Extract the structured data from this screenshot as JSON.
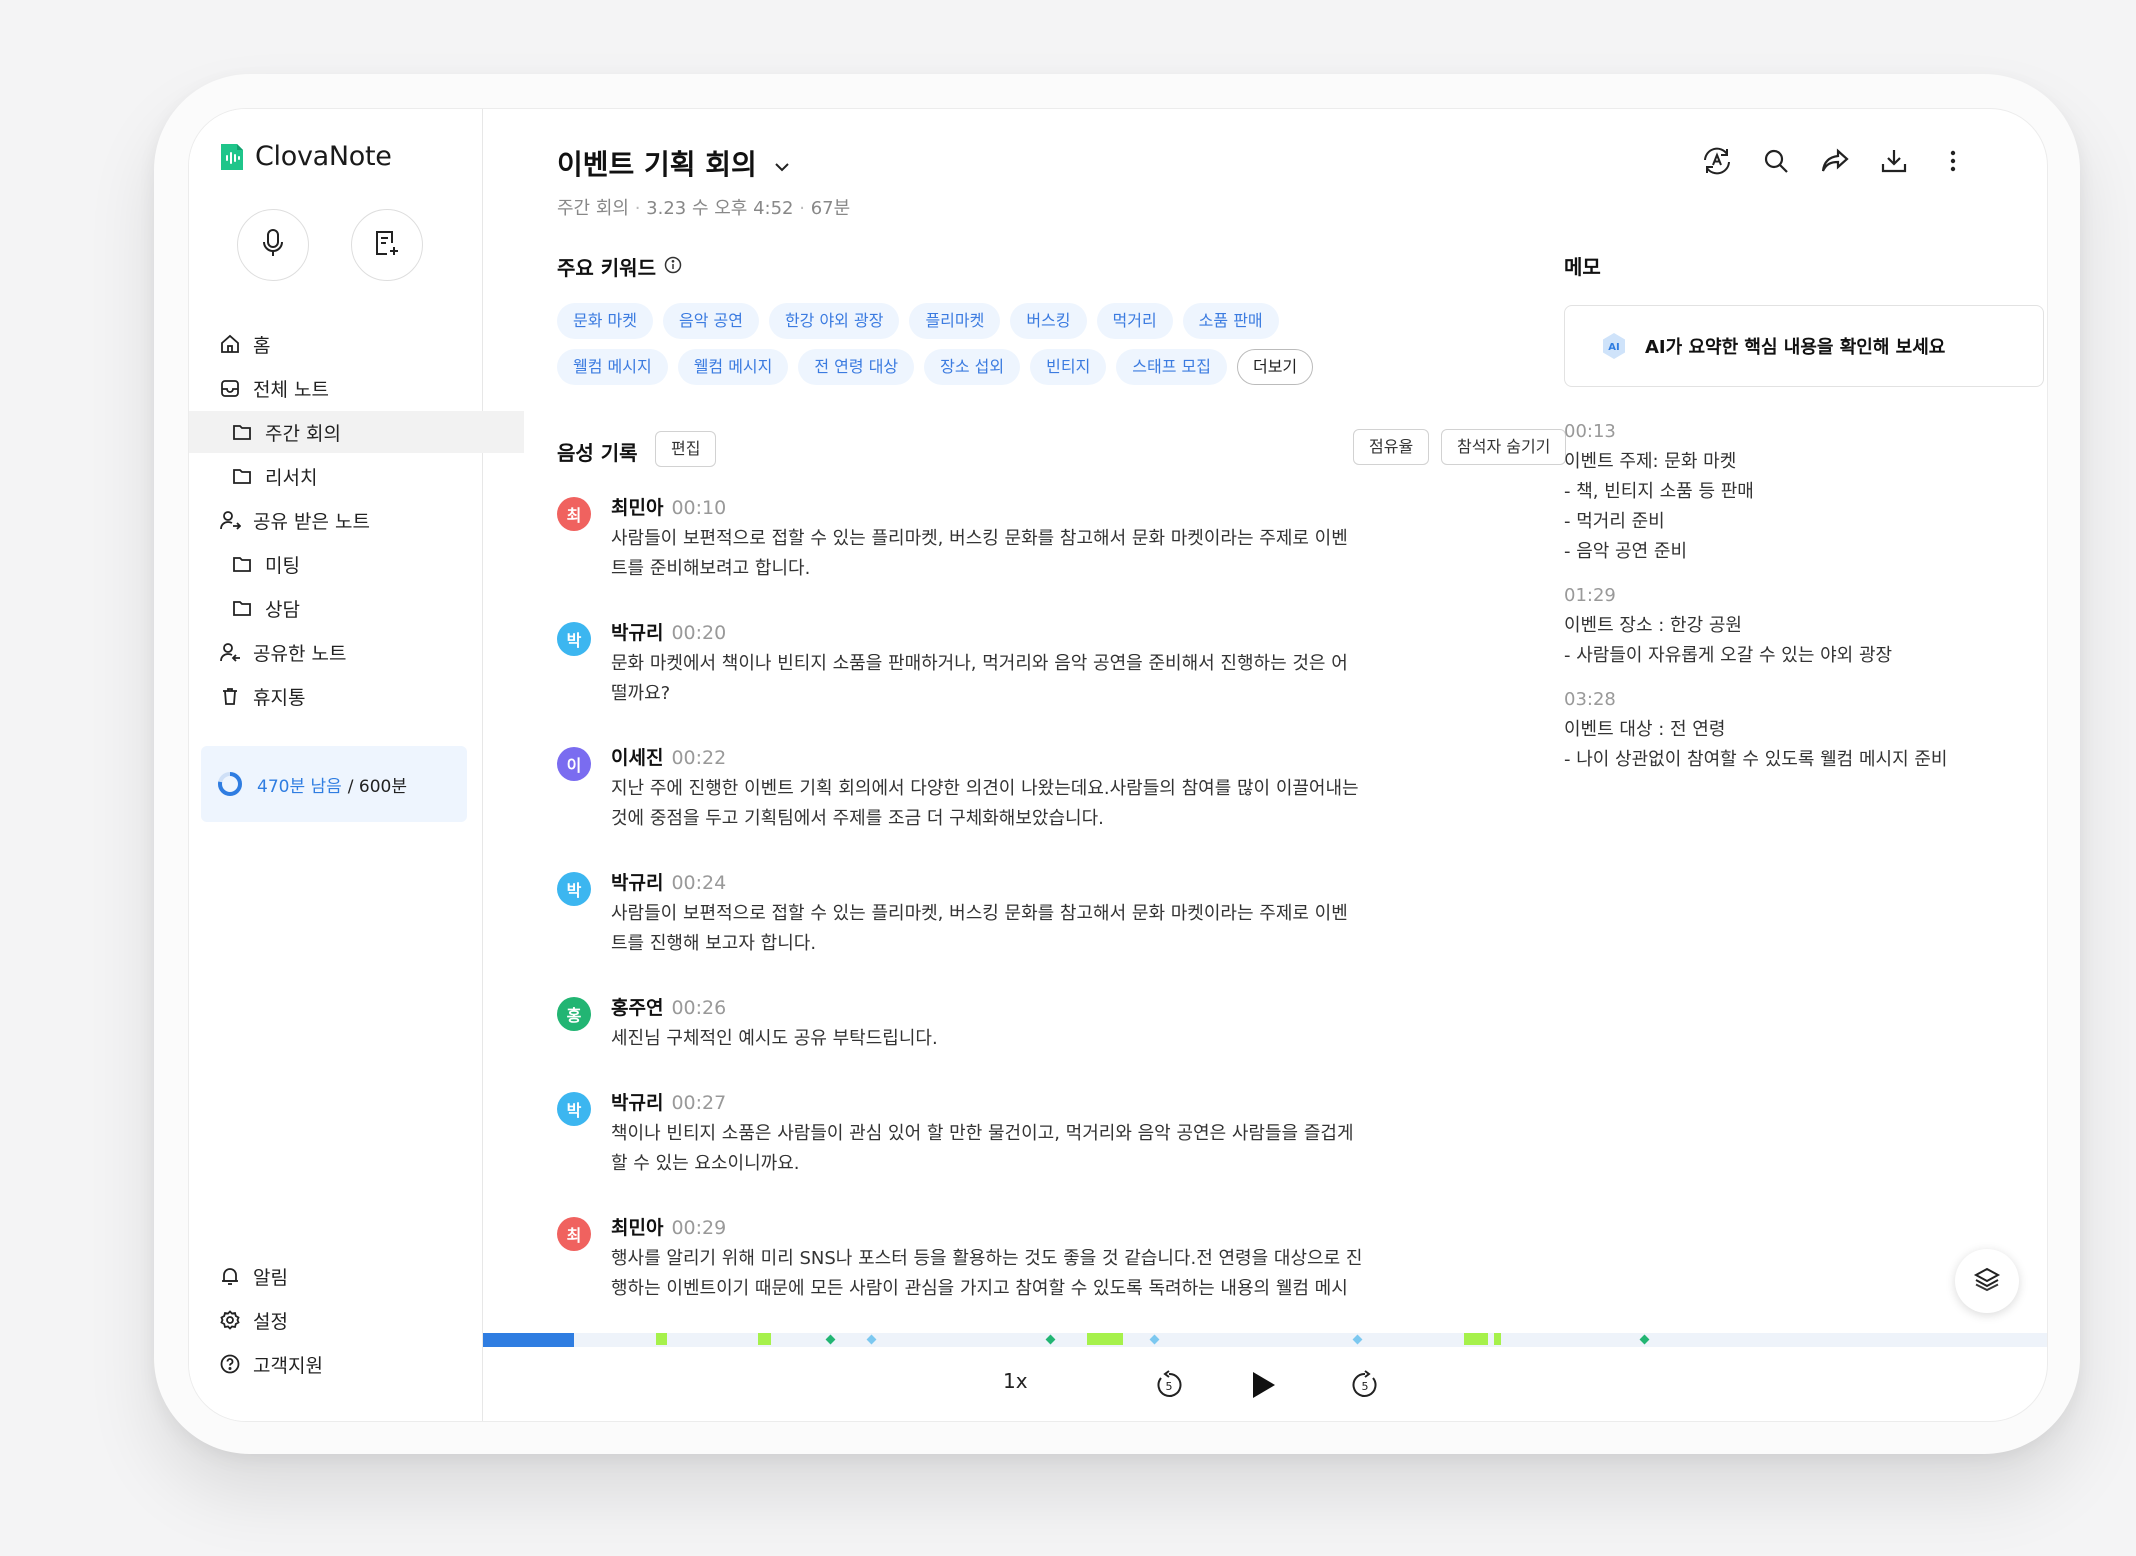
{
  "app": {
    "name": "ClovaNote"
  },
  "sidebar": {
    "items": [
      {
        "label": "홈",
        "icon": "home-icon"
      },
      {
        "label": "전체 노트",
        "icon": "inbox-icon"
      },
      {
        "label": "주간 회의",
        "icon": "folder-icon"
      },
      {
        "label": "리서치",
        "icon": "folder-icon"
      },
      {
        "label": "공유 받은 노트",
        "icon": "person-shared-icon"
      },
      {
        "label": "미팅",
        "icon": "folder-icon"
      },
      {
        "label": "상담",
        "icon": "folder-icon"
      },
      {
        "label": "공유한 노트",
        "icon": "person-share-icon"
      },
      {
        "label": "휴지통",
        "icon": "trash-icon"
      }
    ],
    "usage": {
      "remaining": "470분 남음",
      "total": "/ 600분",
      "used_fraction": 0.78
    },
    "bottom": [
      {
        "label": "알림",
        "icon": "bell-icon"
      },
      {
        "label": "설정",
        "icon": "gear-icon"
      },
      {
        "label": "고객지원",
        "icon": "help-icon"
      }
    ]
  },
  "note": {
    "title": "이벤트 기획 회의",
    "folder": "주간 회의",
    "date": "3.23 수 오후 4:52",
    "duration": "67분"
  },
  "keywords": {
    "label": "주요 키워드",
    "items": [
      "문화 마켓",
      "음악 공연",
      "한강 야외 광장",
      "플리마켓",
      "버스킹",
      "먹거리",
      "소품 판매",
      "웰컴 메시지",
      "웰컴 메시지",
      "전 연령 대상",
      "장소 섭외",
      "빈티지",
      "스태프 모집"
    ],
    "more": "더보기"
  },
  "transcript": {
    "label": "음성 기록",
    "edit": "편집",
    "share_btn": "점유율",
    "hide_btn": "참석자 숨기기",
    "entries": [
      {
        "initial": "최",
        "speaker": "최민아",
        "time": "00:10",
        "color": "#f0625f",
        "lines": [
          "사람들이 보편적으로 접할 수 있는 플리마켓, 버스킹 문화를 참고해서 문화 마켓이라는 주제로 이벤",
          "트를 준비해보려고 합니다."
        ]
      },
      {
        "initial": "박",
        "speaker": "박규리",
        "time": "00:20",
        "color": "#3cb6f0",
        "lines": [
          "문화 마켓에서 책이나 빈티지 소품을 판매하거나, 먹거리와 음악 공연을 준비해서 진행하는 것은 어",
          "떨까요?"
        ]
      },
      {
        "initial": "이",
        "speaker": "이세진",
        "time": "00:22",
        "color": "#7a6cf0",
        "lines": [
          "지난 주에 진행한 이벤트 기획 회의에서 다양한 의견이 나왔는데요.사람들의 참여를 많이 이끌어내는",
          "것에 중점을 두고 기획팀에서 주제를 조금 더 구체화해보았습니다."
        ]
      },
      {
        "initial": "박",
        "speaker": "박규리",
        "time": "00:24",
        "color": "#3cb6f0",
        "lines": [
          "사람들이 보편적으로 접할 수 있는 플리마켓, 버스킹 문화를 참고해서 문화 마켓이라는 주제로 이벤",
          "트를 진행해 보고자 합니다."
        ]
      },
      {
        "initial": "홍",
        "speaker": "홍주연",
        "time": "00:26",
        "color": "#22b573",
        "lines": [
          "세진님 구체적인 예시도 공유 부탁드립니다."
        ]
      },
      {
        "initial": "박",
        "speaker": "박규리",
        "time": "00:27",
        "color": "#3cb6f0",
        "lines": [
          "책이나 빈티지 소품은 사람들이 관심 있어 할 만한 물건이고, 먹거리와 음악 공연은 사람들을 즐겁게",
          "할 수 있는 요소이니까요."
        ]
      },
      {
        "initial": "최",
        "speaker": "최민아",
        "time": "00:29",
        "color": "#f0625f",
        "lines": [
          "행사를 알리기 위해 미리 SNS나 포스터 등을 활용하는 것도 좋을 것 같습니다.전 연령을 대상으로 진",
          "행하는 이벤트이기 때문에 모든 사람이 관심을 가지고 참여할 수 있도록 독려하는 내용의 웰컴 메시"
        ]
      }
    ]
  },
  "memo": {
    "label": "메모",
    "ai_prompt": "AI가 요약한 핵심 내용을 확인해 보세요",
    "ai_badge": "AI",
    "blocks": [
      {
        "time": "00:13",
        "lines": [
          "이벤트 주제: 문화 마켓",
          "- 책, 빈티지 소품 등 판매",
          "- 먹거리 준비",
          "- 음악 공연 준비"
        ]
      },
      {
        "time": "01:29",
        "lines": [
          "이벤트 장소 : 한강 공원",
          "- 사람들이 자유롭게 오갈 수 있는 야외 광장"
        ]
      },
      {
        "time": "03:28",
        "lines": [
          "이벤트 대상 : 전 연령",
          "- 나이 상관없이 참여할 수 있도록 웰컴 메시지 준비"
        ]
      }
    ]
  },
  "player": {
    "speed": "1x",
    "progress_fraction": 0.058,
    "rewind_seconds": "5",
    "forward_seconds": "5",
    "colors": {
      "accent": "#2f7de1",
      "highlight": "#a6f14b",
      "bookmark": "#22c55e",
      "memo": "#7cc8f0"
    }
  }
}
